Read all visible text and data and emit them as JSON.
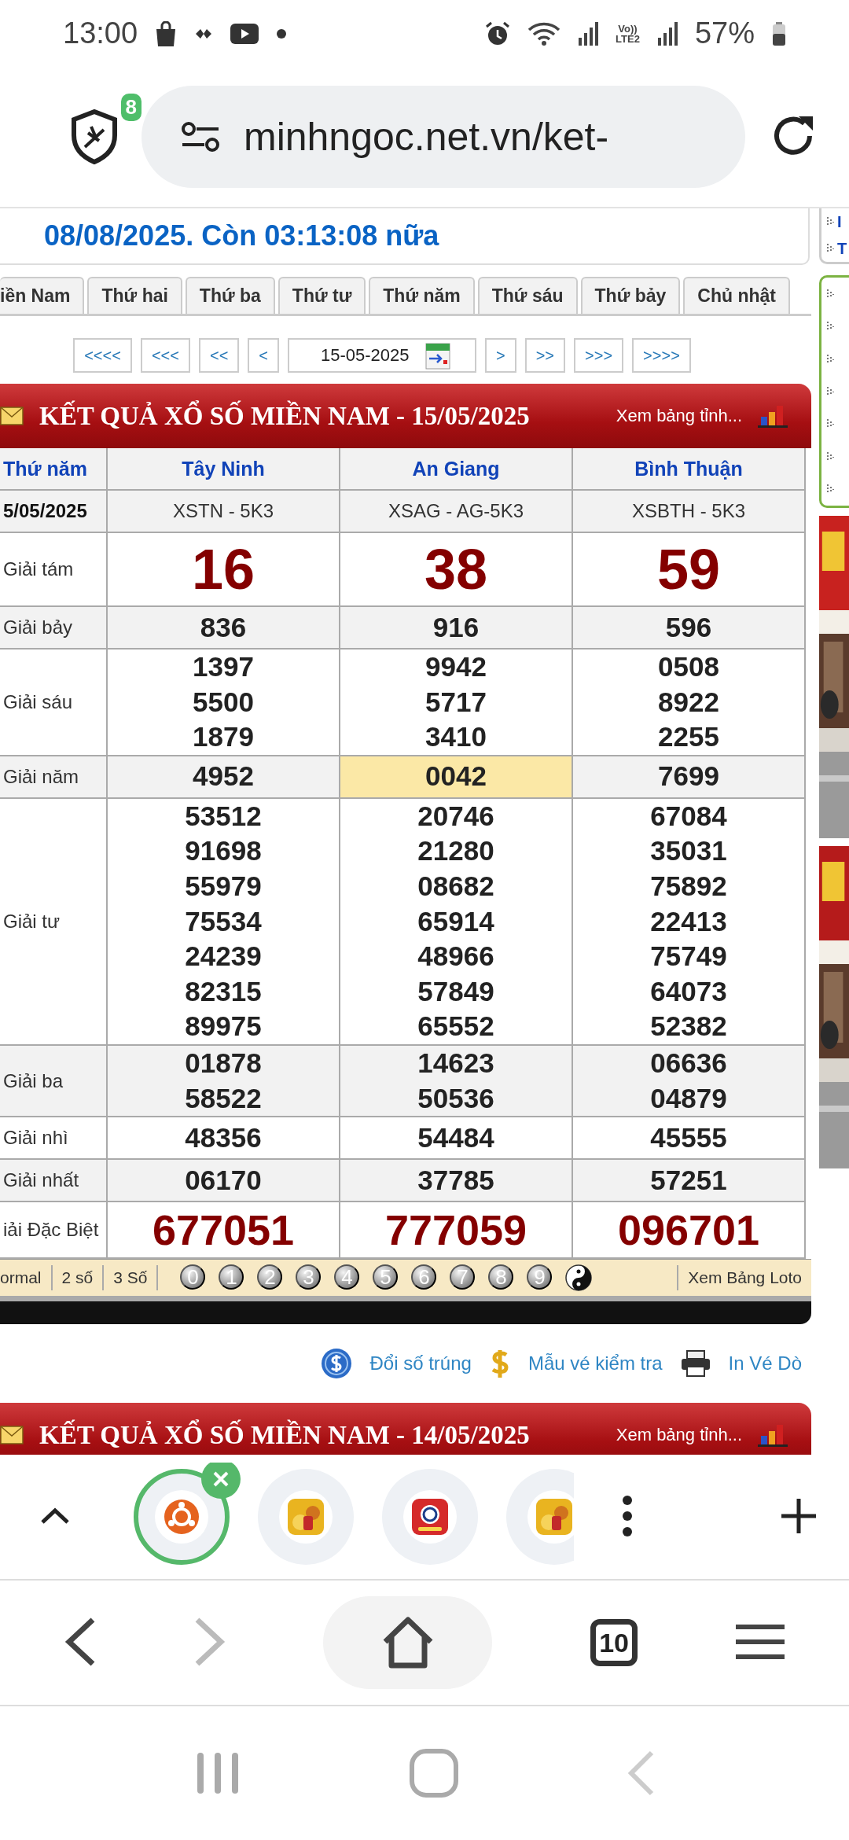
{
  "status_bar": {
    "time": "13:00",
    "volte": [
      "Vo))",
      "LTE2"
    ],
    "battery": "57%"
  },
  "browser": {
    "shield_badge": "8",
    "url": "minhngoc.net.vn/ket-"
  },
  "countdown": "08/08/2025. Còn 03:13:08 nữa",
  "day_tabs": [
    {
      "label": "iền Nam",
      "selected": false
    },
    {
      "label": "Thứ hai",
      "selected": false
    },
    {
      "label": "Thứ ba",
      "selected": false
    },
    {
      "label": "Thứ tư",
      "selected": false
    },
    {
      "label": "Thứ năm",
      "selected": false
    },
    {
      "label": "Thứ sáu",
      "selected": false
    },
    {
      "label": "Thứ bảy",
      "selected": false
    },
    {
      "label": "Chủ nhật",
      "selected": false
    }
  ],
  "date_nav": {
    "back": [
      "<<<<",
      "<<<",
      "<<",
      "<"
    ],
    "date": "15-05-2025",
    "forward": [
      ">",
      ">>",
      ">>>",
      ">>>>"
    ]
  },
  "results": {
    "title": "KẾT QUẢ XỔ SỐ MIỀN NAM - 15/05/2025",
    "table_link": "Xem bảng tỉnh...",
    "weekday": "Thứ năm",
    "date": "5/05/2025",
    "provinces": [
      {
        "name": "Tây Ninh",
        "code": "XSTN - 5K3"
      },
      {
        "name": "An Giang",
        "code": "XSAG - AG-5K3"
      },
      {
        "name": "Bình Thuận",
        "code": "XSBTH - 5K3"
      }
    ],
    "prizes": [
      {
        "name": "Giải tám",
        "kind": "large",
        "cells": [
          {
            "numbers": [
              "16"
            ],
            "highlighted": false
          },
          {
            "numbers": [
              "38"
            ],
            "highlighted": false
          },
          {
            "numbers": [
              "59"
            ],
            "highlighted": false
          }
        ]
      },
      {
        "name": "Giải bảy",
        "kind": "regular",
        "cells": [
          {
            "numbers": [
              "836"
            ],
            "highlighted": false
          },
          {
            "numbers": [
              "916"
            ],
            "highlighted": false
          },
          {
            "numbers": [
              "596"
            ],
            "highlighted": false
          }
        ]
      },
      {
        "name": "Giải sáu",
        "kind": "regular",
        "cells": [
          {
            "numbers": [
              "1397",
              "5500",
              "1879"
            ],
            "highlighted": false
          },
          {
            "numbers": [
              "9942",
              "5717",
              "3410"
            ],
            "highlighted": false
          },
          {
            "numbers": [
              "0508",
              "8922",
              "2255"
            ],
            "highlighted": false
          }
        ]
      },
      {
        "name": "Giải năm",
        "kind": "regular",
        "cells": [
          {
            "numbers": [
              "4952"
            ],
            "highlighted": false
          },
          {
            "numbers": [
              "0042"
            ],
            "highlighted": true
          },
          {
            "numbers": [
              "7699"
            ],
            "highlighted": false
          }
        ]
      },
      {
        "name": "Giải tư",
        "kind": "regular",
        "cells": [
          {
            "numbers": [
              "53512",
              "91698",
              "55979",
              "75534",
              "24239",
              "82315",
              "89975"
            ],
            "highlighted": false
          },
          {
            "numbers": [
              "20746",
              "21280",
              "08682",
              "65914",
              "48966",
              "57849",
              "65552"
            ],
            "highlighted": false
          },
          {
            "numbers": [
              "67084",
              "35031",
              "75892",
              "22413",
              "75749",
              "64073",
              "52382"
            ],
            "highlighted": false
          }
        ]
      },
      {
        "name": "Giải ba",
        "kind": "regular",
        "cells": [
          {
            "numbers": [
              "01878",
              "58522"
            ],
            "highlighted": false
          },
          {
            "numbers": [
              "14623",
              "50536"
            ],
            "highlighted": false
          },
          {
            "numbers": [
              "06636",
              "04879"
            ],
            "highlighted": false
          }
        ]
      },
      {
        "name": "Giải nhì",
        "kind": "regular",
        "cells": [
          {
            "numbers": [
              "48356"
            ],
            "highlighted": false
          },
          {
            "numbers": [
              "54484"
            ],
            "highlighted": false
          },
          {
            "numbers": [
              "45555"
            ],
            "highlighted": false
          }
        ]
      },
      {
        "name": "Giải nhất",
        "kind": "regular",
        "cells": [
          {
            "numbers": [
              "06170"
            ],
            "highlighted": false
          },
          {
            "numbers": [
              "37785"
            ],
            "highlighted": false
          },
          {
            "numbers": [
              "57251"
            ],
            "highlighted": false
          }
        ]
      },
      {
        "name": "iải Đặc Biệt",
        "kind": "special",
        "cells": [
          {
            "numbers": [
              "677051"
            ],
            "highlighted": false
          },
          {
            "numbers": [
              "777059"
            ],
            "highlighted": false
          },
          {
            "numbers": [
              "096701"
            ],
            "highlighted": false
          }
        ]
      }
    ],
    "loto_modes": [
      "ormal",
      "2 số",
      "3 Số"
    ],
    "digits": [
      "0",
      "1",
      "2",
      "3",
      "4",
      "5",
      "6",
      "7",
      "8",
      "9"
    ],
    "loto_link": "Xem Bảng Loto"
  },
  "links": [
    {
      "kind": "coin",
      "label": "Đổi số trúng"
    },
    {
      "kind": "dollar",
      "label": "Mẫu vé kiểm tra"
    },
    {
      "kind": "printer",
      "label": "In Vé Dò"
    }
  ],
  "next_results": {
    "title": "KẾT QUẢ XỔ SỐ MIỀN NAM - 14/05/2025",
    "table_link": "Xem bảng tỉnh..."
  },
  "sidebar": {
    "top_items": [
      "I",
      "T"
    ]
  },
  "tab_strip": [
    {
      "kind": "ring",
      "selected": true
    },
    {
      "kind": "gold",
      "selected": false
    },
    {
      "kind": "live",
      "selected": false
    },
    {
      "kind": "gold",
      "selected": false
    }
  ],
  "nav": {
    "forward_disabled": true,
    "tab_count": "10"
  }
}
